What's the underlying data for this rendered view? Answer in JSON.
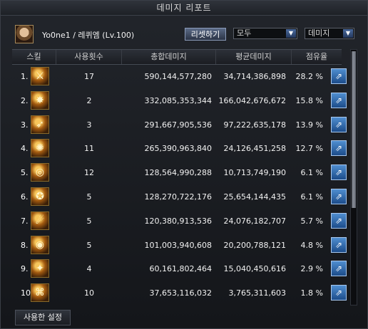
{
  "window": {
    "title": "데미지 리포트"
  },
  "header": {
    "character": "Yo0ne1 / 레퀴엠 (Lv.100)",
    "reset_label": "리셋하기",
    "filter_select": "모두",
    "metric_select": "데미지"
  },
  "table": {
    "columns": [
      "스킬",
      "사용횟수",
      "총합데미지",
      "평균데미지",
      "점유율"
    ],
    "rows": [
      {
        "rank": "1.",
        "icon": "sword-skill-icon",
        "count": "17",
        "total": "590,144,577,280",
        "avg": "34,714,386,898",
        "share": "28.2 %"
      },
      {
        "rank": "2.",
        "icon": "fire-slash-skill-icon",
        "count": "2",
        "total": "332,085,353,344",
        "avg": "166,042,676,672",
        "share": "15.8 %"
      },
      {
        "rank": "3.",
        "icon": "strike-skill-icon",
        "count": "3",
        "total": "291,667,905,536",
        "avg": "97,222,635,178",
        "share": "13.9 %"
      },
      {
        "rank": "4.",
        "icon": "spin-skill-icon",
        "count": "11",
        "total": "265,390,963,840",
        "avg": "24,126,451,258",
        "share": "12.7 %"
      },
      {
        "rank": "5.",
        "icon": "burst-skill-icon",
        "count": "12",
        "total": "128,564,990,288",
        "avg": "10,713,749,190",
        "share": "6.1 %"
      },
      {
        "rank": "6.",
        "icon": "red-seal-skill-icon",
        "count": "5",
        "total": "128,270,722,176",
        "avg": "25,654,144,435",
        "share": "6.1 %"
      },
      {
        "rank": "7.",
        "icon": "wave-skill-icon",
        "count": "5",
        "total": "120,380,913,536",
        "avg": "24,076,182,707",
        "share": "5.7 %"
      },
      {
        "rank": "8.",
        "icon": "orb-skill-icon",
        "count": "5",
        "total": "101,003,940,608",
        "avg": "20,200,788,121",
        "share": "4.8 %"
      },
      {
        "rank": "9.",
        "icon": "flare-skill-icon",
        "count": "4",
        "total": "60,161,802,464",
        "avg": "15,040,450,616",
        "share": "2.9 %"
      },
      {
        "rank": "10.",
        "icon": "rune-skill-icon",
        "count": "10",
        "total": "37,653,116,032",
        "avg": "3,765,311,603",
        "share": "1.8 %"
      }
    ]
  },
  "footer": {
    "tab_label": "사용한 설정"
  }
}
